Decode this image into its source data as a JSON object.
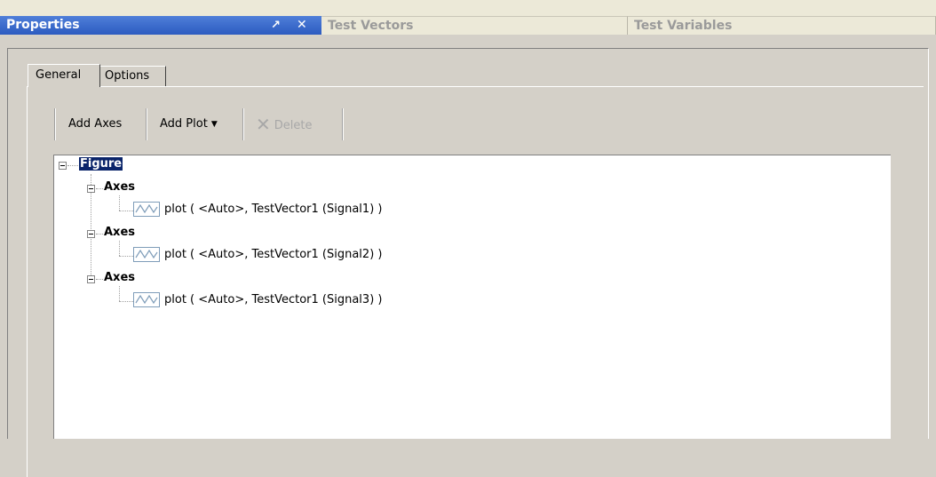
{
  "panel_tabs": {
    "properties": "Properties",
    "pin_glyph": "ⴰ",
    "close_glyph": "✕",
    "test_vectors": "Test Vectors",
    "test_variables": "Test Variables"
  },
  "inner_tabs": {
    "general": "General",
    "options": "Options"
  },
  "toolbar": {
    "add_axes": "Add Axes",
    "add_plot": "Add Plot",
    "delete": "Delete"
  },
  "tree": {
    "root": "Figure",
    "axes": [
      {
        "label": "Axes",
        "plot": "plot ( <Auto>, TestVector1 (Signal1) )"
      },
      {
        "label": "Axes",
        "plot": "plot ( <Auto>, TestVector1 (Signal2) )"
      },
      {
        "label": "Axes",
        "plot": "plot ( <Auto>, TestVector1 (Signal3) )"
      }
    ]
  },
  "colors": {
    "active_tab": "#2c5bc0",
    "selection": "#0a246a",
    "window_bg": "#d4d0c8"
  }
}
